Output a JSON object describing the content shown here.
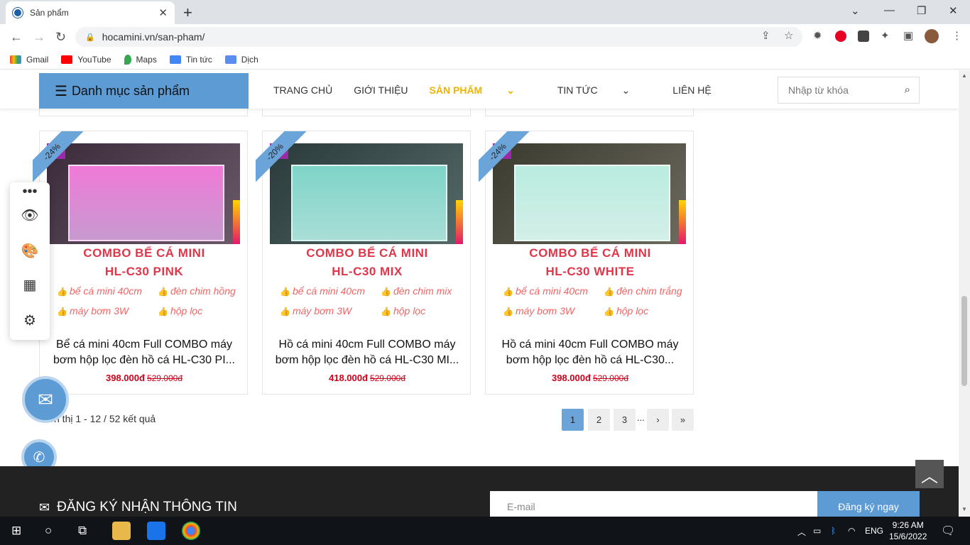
{
  "browser": {
    "tab_title": "Sản phẩm",
    "url": "hocamini.vn/san-pham/",
    "bookmarks": [
      "Gmail",
      "YouTube",
      "Maps",
      "Tin tức",
      "Dịch"
    ]
  },
  "site": {
    "category_button": "Danh mục sản phẩm",
    "nav": [
      "TRANG CHỦ",
      "GIỚI THIỆU",
      "SẢN PHẨM",
      "TIN TỨC",
      "LIÊN HỆ"
    ],
    "search_placeholder": "Nhập từ khóa"
  },
  "products": [
    {
      "badge": "-24%",
      "combo_line1": "COMBO BỂ CÁ MINI",
      "combo_line2": "HL-C30 PINK",
      "features": [
        "bể cá mini 40cm",
        "đèn chim hồng",
        "máy bơm 3W",
        "hộp lọc"
      ],
      "name_line1": "Bể cá mini 40cm Full COMBO máy",
      "name_line2": "bơm hộp lọc đèn hồ cá HL-C30 PI...",
      "price": "398.000đ",
      "old_price": "529.000đ",
      "image_colors": [
        "#3a2a3a",
        "#f07ad8"
      ]
    },
    {
      "badge": "-20%",
      "combo_line1": "COMBO BỂ CÁ MINI",
      "combo_line2": "HL-C30 MIX",
      "features": [
        "bể cá mini 40cm",
        "đèn chim mix",
        "máy bơm 3W",
        "hộp lọc"
      ],
      "name_line1": "Hồ cá mini 40cm Full COMBO máy",
      "name_line2": "bơm hộp lọc đèn hồ cá HL-C30 MI...",
      "price": "418.000đ",
      "old_price": "529.000đ",
      "image_colors": [
        "#2a3a3a",
        "#7fd4c9"
      ]
    },
    {
      "badge": "-24%",
      "combo_line1": "COMBO BỂ CÁ MINI",
      "combo_line2": "HL-C30 WHITE",
      "features": [
        "bể cá mini 40cm",
        "đèn chim trắng",
        "máy bơm 3W",
        "hộp lọc"
      ],
      "name_line1": "Hồ cá mini 40cm Full COMBO máy",
      "name_line2": "bơm hộp lọc đèn hồ cá HL-C30...",
      "price": "398.000đ",
      "old_price": "529.000đ",
      "image_colors": [
        "#3a3a2e",
        "#b9ecdf"
      ]
    }
  ],
  "results": "Hiển thị 1 - 12 / 52 kết quả",
  "pagination": [
    "1",
    "2",
    "3",
    "..."
  ],
  "footer": {
    "subscribe_title": "ĐĂNG KÝ NHẬN THÔNG TIN",
    "email_placeholder": "E-mail",
    "register_button": "Đăng ký ngay"
  },
  "taskbar": {
    "lang": "ENG",
    "time": "9:26 AM",
    "date": "15/6/2022"
  }
}
